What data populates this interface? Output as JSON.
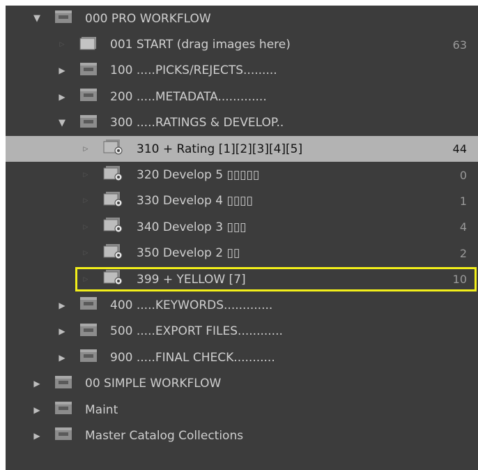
{
  "tree": {
    "items": [
      {
        "label": "000 PRO WORKFLOW",
        "count": "",
        "state": "expanded",
        "depth": 0
      },
      {
        "label": "001 START (drag images here)",
        "count": "63",
        "state": "leaf",
        "depth": 1
      },
      {
        "label": "100 .....PICKS/REJECTS.........",
        "count": "",
        "state": "collapsed",
        "depth": 1
      },
      {
        "label": "200 .....METADATA.............",
        "count": "",
        "state": "collapsed",
        "depth": 1
      },
      {
        "label": "300 .....RATINGS & DEVELOP..",
        "count": "",
        "state": "expanded",
        "depth": 1
      },
      {
        "label": "310 + Rating [1][2][3][4][5]",
        "count": "44",
        "state": "smart",
        "depth": 2,
        "selected": true
      },
      {
        "label": "320 Develop 5 ▯▯▯▯▯",
        "count": "0",
        "state": "smart",
        "depth": 2
      },
      {
        "label": "330  Develop 4 ▯▯▯▯",
        "count": "1",
        "state": "smart",
        "depth": 2
      },
      {
        "label": "340   Develop 3 ▯▯▯",
        "count": "4",
        "state": "smart",
        "depth": 2
      },
      {
        "label": "350    Develop 2 ▯▯",
        "count": "2",
        "state": "smart",
        "depth": 2
      },
      {
        "label": "399      + YELLOW [7]",
        "count": "10",
        "state": "smart",
        "depth": 2,
        "highlighted": true
      },
      {
        "label": "400 .....KEYWORDS.............",
        "count": "",
        "state": "collapsed",
        "depth": 1
      },
      {
        "label": "500 .....EXPORT FILES............",
        "count": "",
        "state": "collapsed",
        "depth": 1
      },
      {
        "label": "900 .....FINAL CHECK...........",
        "count": "",
        "state": "collapsed",
        "depth": 1
      },
      {
        "label": "00 SIMPLE WORKFLOW",
        "count": "",
        "state": "collapsed",
        "depth": 0
      },
      {
        "label": "Maint",
        "count": "",
        "state": "collapsed",
        "depth": 0
      },
      {
        "label": "Master Catalog Collections",
        "count": "",
        "state": "collapsed",
        "depth": 0
      }
    ]
  },
  "colors": {
    "panel_bg": "#3c3c3c",
    "selected_bg": "#b3b3b3",
    "highlight_border": "#f2ef1a",
    "text": "#cfcfcf"
  }
}
